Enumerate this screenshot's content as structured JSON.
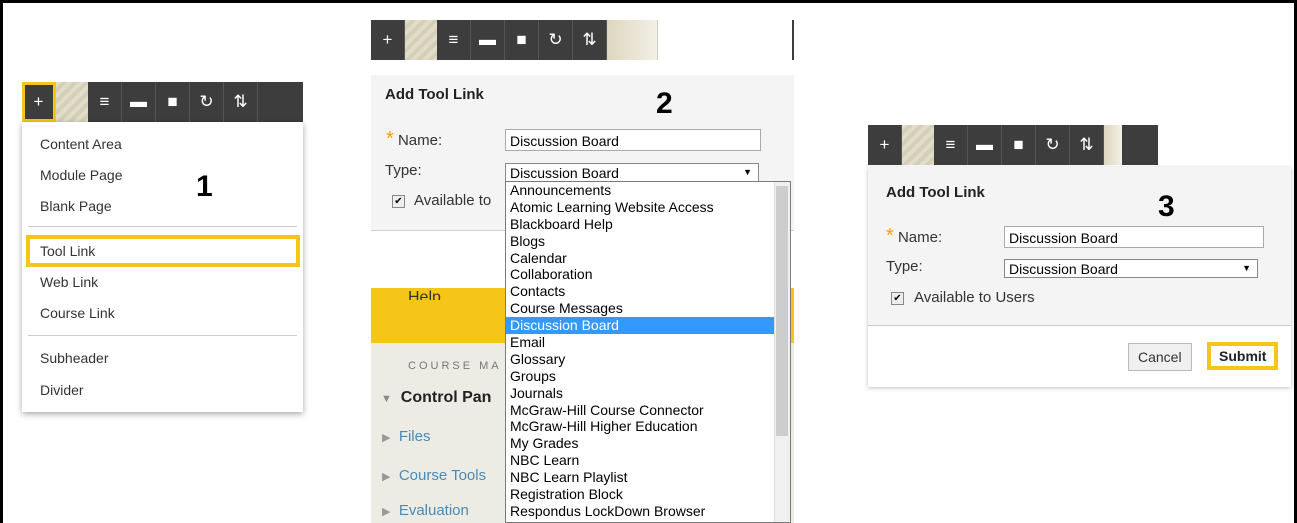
{
  "toolbar": {
    "add_icon": "plus-icon",
    "list_icon": "list-icon",
    "folder_icon": "folder-icon",
    "window_icon": "window-icon",
    "refresh_icon": "refresh-icon",
    "sort_icon": "sort-icon"
  },
  "steps": {
    "one": "1",
    "two": "2",
    "three": "3"
  },
  "add_menu": {
    "items": [
      "Content Area",
      "Module Page",
      "Blank Page",
      "Tool Link",
      "Web Link",
      "Course Link",
      "Subheader",
      "Divider"
    ],
    "highlighted": "Tool Link"
  },
  "form": {
    "title": "Add Tool Link",
    "name_label": "Name:",
    "name_value": "Discussion Board",
    "type_label": "Type:",
    "type_value": "Discussion Board",
    "available_label_partial": "Available to",
    "available_label": "Available to Users",
    "available_checked": true,
    "cancel_label": "Cancel",
    "submit_label": "Submit"
  },
  "type_options": [
    "Announcements",
    "Atomic Learning Website Access",
    "Blackboard Help",
    "Blogs",
    "Calendar",
    "Collaboration",
    "Contacts",
    "Course Messages",
    "Discussion Board",
    "Email",
    "Glossary",
    "Groups",
    "Journals",
    "McGraw-Hill Course Connector",
    "McGraw-Hill Higher Education",
    "My Grades",
    "NBC Learn",
    "NBC Learn Playlist",
    "Registration Block",
    "Respondus LockDown Browser"
  ],
  "selected_option": "Discussion Board",
  "course_menu": {
    "help": "Help",
    "section_heading": "COURSE MA",
    "control_panel": "Control Pan",
    "files": "Files",
    "course_tools": "Course Tools",
    "evaluation": "Evaluation"
  },
  "colors": {
    "accent": "#f5c518",
    "toolbar": "#3d3d3d",
    "selection": "#3399ff",
    "link": "#4a8ab5"
  }
}
